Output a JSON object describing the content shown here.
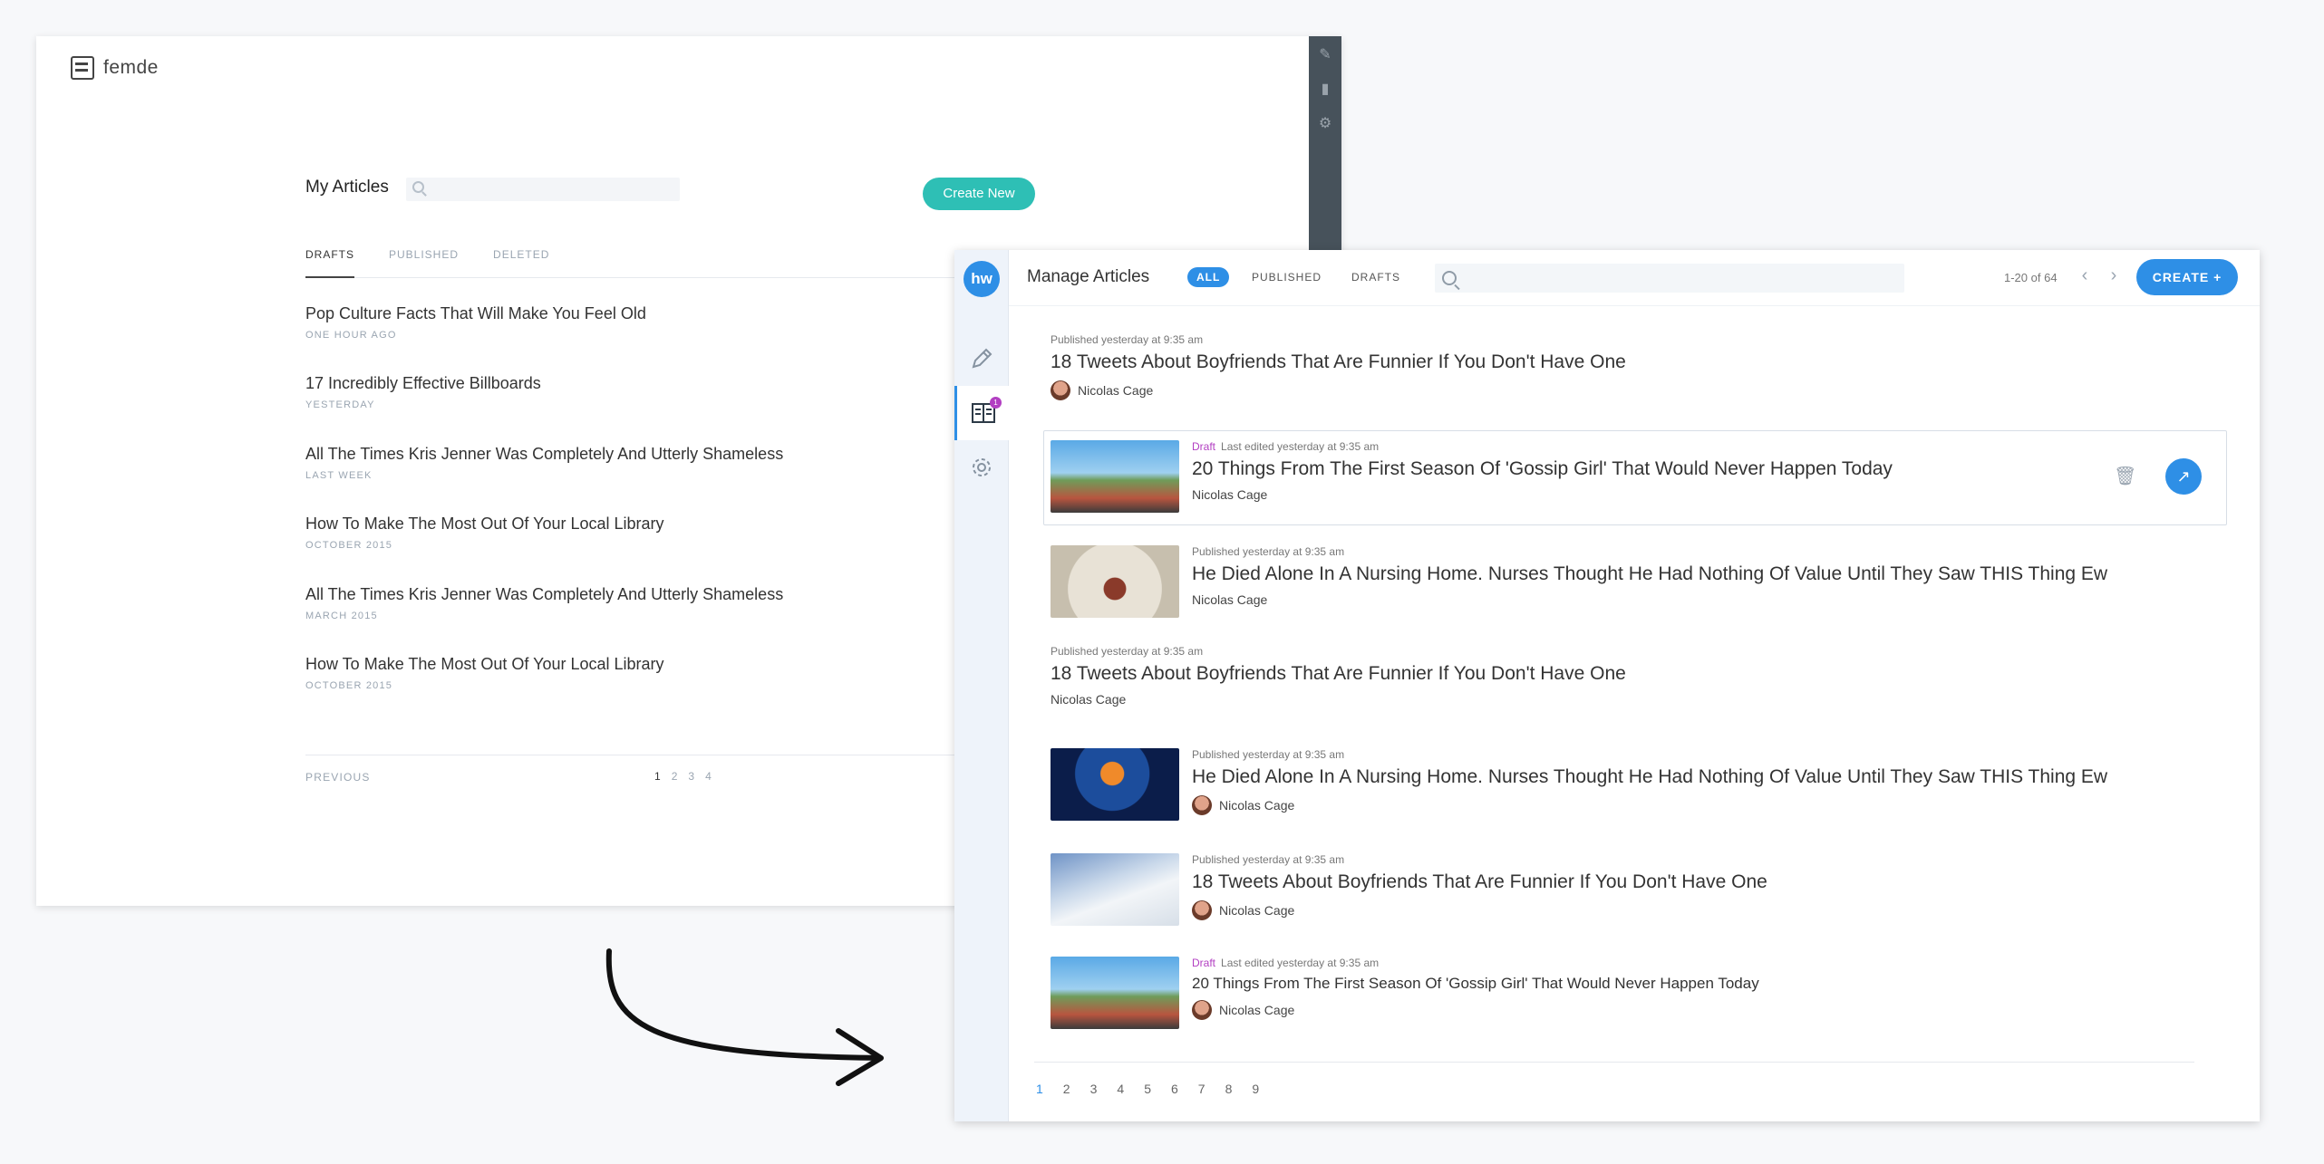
{
  "old_app": {
    "brand": "femde",
    "title": "My Articles",
    "search_placeholder": "",
    "create_label": "Create New",
    "tabs": [
      "DRAFTS",
      "PUBLISHED",
      "DELETED"
    ],
    "articles": [
      {
        "title": "Pop Culture Facts That Will Make You Feel Old",
        "date": "ONE HOUR AGO"
      },
      {
        "title": "17 Incredibly Effective Billboards",
        "date": "YESTERDAY"
      },
      {
        "title": "All The Times Kris Jenner Was Completely And Utterly Shameless",
        "date": "LAST WEEK"
      },
      {
        "title": "How To Make The Most Out Of Your Local Library",
        "date": "OCTOBER 2015"
      },
      {
        "title": "All The Times Kris Jenner Was Completely And Utterly Shameless",
        "date": "MARCH 2015"
      },
      {
        "title": "How To Make The Most Out Of Your Local Library",
        "date": "OCTOBER 2015"
      }
    ],
    "previous_label": "PREVIOUS",
    "pages": [
      "1",
      "2",
      "3",
      "4"
    ]
  },
  "new_app": {
    "brand": "hw",
    "badge": "1",
    "title": "Manage Articles",
    "filters": [
      "ALL",
      "PUBLISHED",
      "DRAFTS"
    ],
    "search_placeholder": "",
    "range": "1-20 of 64",
    "create_label": "CREATE  +",
    "rows": [
      {
        "status": "",
        "meta": "Published yesterday at 9:35 am",
        "title": "18 Tweets About Boyfriends That Are Funnier If You Don't Have One",
        "author": "Nicolas Cage"
      },
      {
        "status": "Draft",
        "meta": "Last edited yesterday at 9:35 am",
        "title": "20 Things From The First Season Of 'Gossip Girl' That Would Never Happen Today",
        "author": "Nicolas Cage"
      },
      {
        "status": "",
        "meta": "Published yesterday at 9:35 am",
        "title": "He Died Alone In A Nursing Home. Nurses Thought He Had Nothing Of Value Until They Saw THIS Thing Ew",
        "author": "Nicolas Cage"
      },
      {
        "status": "",
        "meta": "Published yesterday at 9:35 am",
        "title": "18 Tweets About Boyfriends That Are Funnier If You Don't Have One",
        "author": "Nicolas Cage"
      },
      {
        "status": "",
        "meta": "Published yesterday at 9:35 am",
        "title": "He Died Alone In A Nursing Home. Nurses Thought He Had Nothing Of Value Until They Saw THIS Thing Ew",
        "author": "Nicolas Cage"
      },
      {
        "status": "",
        "meta": "Published yesterday at 9:35 am",
        "title": "18 Tweets About Boyfriends That Are Funnier If You Don't Have One",
        "author": "Nicolas Cage"
      },
      {
        "status": "Draft",
        "meta": "Last edited yesterday at 9:35 am",
        "title": "20 Things From The First Season Of 'Gossip Girl' That Would Never Happen Today",
        "author": "Nicolas Cage"
      }
    ],
    "pages": [
      "1",
      "2",
      "3",
      "4",
      "5",
      "6",
      "7",
      "8",
      "9"
    ]
  },
  "colors": {
    "accent_teal": "#2ebfb5",
    "accent_blue": "#2e8fe6",
    "draft_purple": "#b23fc2"
  }
}
